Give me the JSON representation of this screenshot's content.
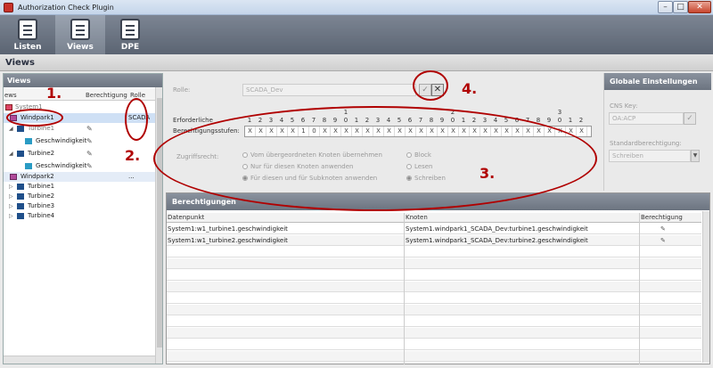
{
  "window": {
    "title": "Authorization Check Plugin"
  },
  "toolbar": {
    "tabs": [
      {
        "label": "Listen"
      },
      {
        "label": "Views"
      },
      {
        "label": "DPE"
      }
    ]
  },
  "header": {
    "title": "Views"
  },
  "left": {
    "title": "Views",
    "columns": [
      "ews",
      "Berechtigung",
      "Rolle"
    ],
    "rows": [
      {
        "name": "System1",
        "role": ""
      },
      {
        "name": "Windpark1",
        "role": "SCADA"
      },
      {
        "name": "Turbine1",
        "role": ""
      },
      {
        "name": "Geschwindigkeit",
        "role": ""
      },
      {
        "name": "Turbine2",
        "role": ""
      },
      {
        "name": "Geschwindigkeit",
        "role": ""
      },
      {
        "name": "Windpark2",
        "role": "..."
      },
      {
        "name": "Turbine1",
        "role": ""
      },
      {
        "name": "Turbine2",
        "role": ""
      },
      {
        "name": "Turbine3",
        "role": ""
      },
      {
        "name": "Turbine4",
        "role": ""
      }
    ]
  },
  "form": {
    "role_label": "Rolle:",
    "role_value": "SCADA_Dev",
    "confirm": "✓",
    "cancel": "✕",
    "required_label": "Erforderliche",
    "levels_label": "Berechtigungsstufen:",
    "tens": [
      "1",
      "2",
      "3"
    ],
    "units": [
      "1",
      "2",
      "3",
      "4",
      "5",
      "6",
      "7",
      "8",
      "9",
      "0",
      "1",
      "2",
      "3",
      "4",
      "5",
      "6",
      "7",
      "8",
      "9",
      "0",
      "1",
      "2",
      "3",
      "4",
      "5",
      "6",
      "7",
      "8",
      "9",
      "0",
      "1",
      "2"
    ],
    "bits": [
      "X",
      "X",
      "X",
      "X",
      "X",
      "1",
      "0",
      "X",
      "X",
      "X",
      "X",
      "X",
      "X",
      "X",
      "X",
      "X",
      "X",
      "X",
      "X",
      "X",
      "X",
      "X",
      "X",
      "X",
      "X",
      "X",
      "X",
      "X",
      "X",
      "X",
      "X",
      "X"
    ],
    "access_label": "Zugriffsrecht:",
    "options_left": [
      "Vom übergeordneten Knoten übernehmen",
      "Nur für diesen Knoten anwenden",
      "Für diesen und für Subknoten anwenden"
    ],
    "options_right": [
      "Block",
      "Lesen",
      "Schreiben"
    ]
  },
  "global": {
    "title": "Globale Einstellungen",
    "cns_label": "CNS Key:",
    "cns_value": "OA:ACP",
    "std_label": "Standardberechtigung:",
    "std_value": "Schreiben"
  },
  "berechtigungen": {
    "title": "Berechtigungen",
    "columns": [
      "Datenpunkt",
      "Knoten",
      "Berechtigung"
    ],
    "rows": [
      {
        "dp": "System1:w1_turbine1.geschwindigkeit",
        "node": "System1.windpark1_SCADA_Dev:turbine1.geschwindigkeit"
      },
      {
        "dp": "System1:w1_turbine2.geschwindigkeit",
        "node": "System1.windpark1_SCADA_Dev:turbine2.geschwindigkeit"
      }
    ]
  },
  "annotations": [
    "1.",
    "2.",
    "3.",
    "4."
  ]
}
